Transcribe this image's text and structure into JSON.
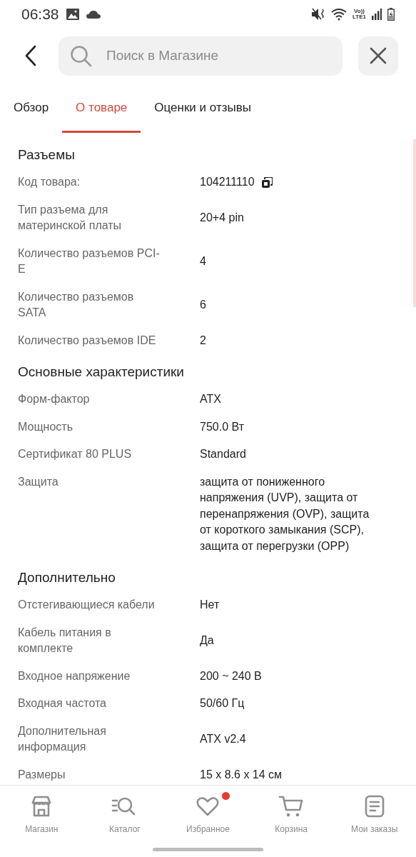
{
  "status_bar": {
    "time": "06:38",
    "network_top": "Vo))",
    "network_bottom": "LTE1"
  },
  "search": {
    "placeholder": "Поиск в Магазине"
  },
  "tabs": [
    {
      "label": "Обзор",
      "selected": false
    },
    {
      "label": "О товаре",
      "selected": true
    },
    {
      "label": "Оценки и отзывы",
      "selected": false
    }
  ],
  "sections": [
    {
      "title": "Разъемы",
      "rows": [
        {
          "label": "Код товара:",
          "value": "104211110",
          "copyable": true
        },
        {
          "label": "Тип разъема для материнской платы",
          "value": "20+4 pin",
          "copyable": false
        },
        {
          "label": "Количество разъемов PCI-E",
          "value": "4",
          "copyable": false
        },
        {
          "label": "Количество разъемов SATA",
          "value": "6",
          "copyable": false
        },
        {
          "label": "Количество разъемов IDE",
          "value": "2",
          "copyable": false
        }
      ]
    },
    {
      "title": "Основные характеристики",
      "rows": [
        {
          "label": "Форм-фактор",
          "value": "ATX",
          "copyable": false
        },
        {
          "label": "Мощность",
          "value": "750.0 Вт",
          "copyable": false
        },
        {
          "label": "Сертификат 80 PLUS",
          "value": "Standard",
          "copyable": false
        },
        {
          "label": "Защита",
          "value": "защита от пониженного напряжения (UVP), защита от перенапряжения (OVP), защита от короткого замыкания (SCP), защита от перегрузки (OPP)",
          "copyable": false
        }
      ]
    },
    {
      "title": "Дополнительно",
      "rows": [
        {
          "label": "Отстегивающиеся кабели",
          "value": "Нет",
          "copyable": false
        },
        {
          "label": "Кабель питания в комплекте",
          "value": "Да",
          "copyable": false
        },
        {
          "label": "Входное напряжение",
          "value": "200 ~ 240 В",
          "copyable": false
        },
        {
          "label": "Входная частота",
          "value": "50/60 Гц",
          "copyable": false
        },
        {
          "label": "Дополнительная информация",
          "value": "ATX v2.4",
          "copyable": false
        },
        {
          "label": "Размеры",
          "value": "15 x 8.6 x 14 см",
          "copyable": false
        }
      ]
    }
  ],
  "nav": [
    {
      "kind": "shop",
      "label": "Магазин",
      "badge": false
    },
    {
      "kind": "catalog",
      "label": "Каталог",
      "badge": false
    },
    {
      "kind": "favorites",
      "label": "Избранное",
      "badge": true
    },
    {
      "kind": "cart",
      "label": "Корзина",
      "badge": false
    },
    {
      "kind": "orders",
      "label": "Мои заказы",
      "badge": false
    }
  ]
}
